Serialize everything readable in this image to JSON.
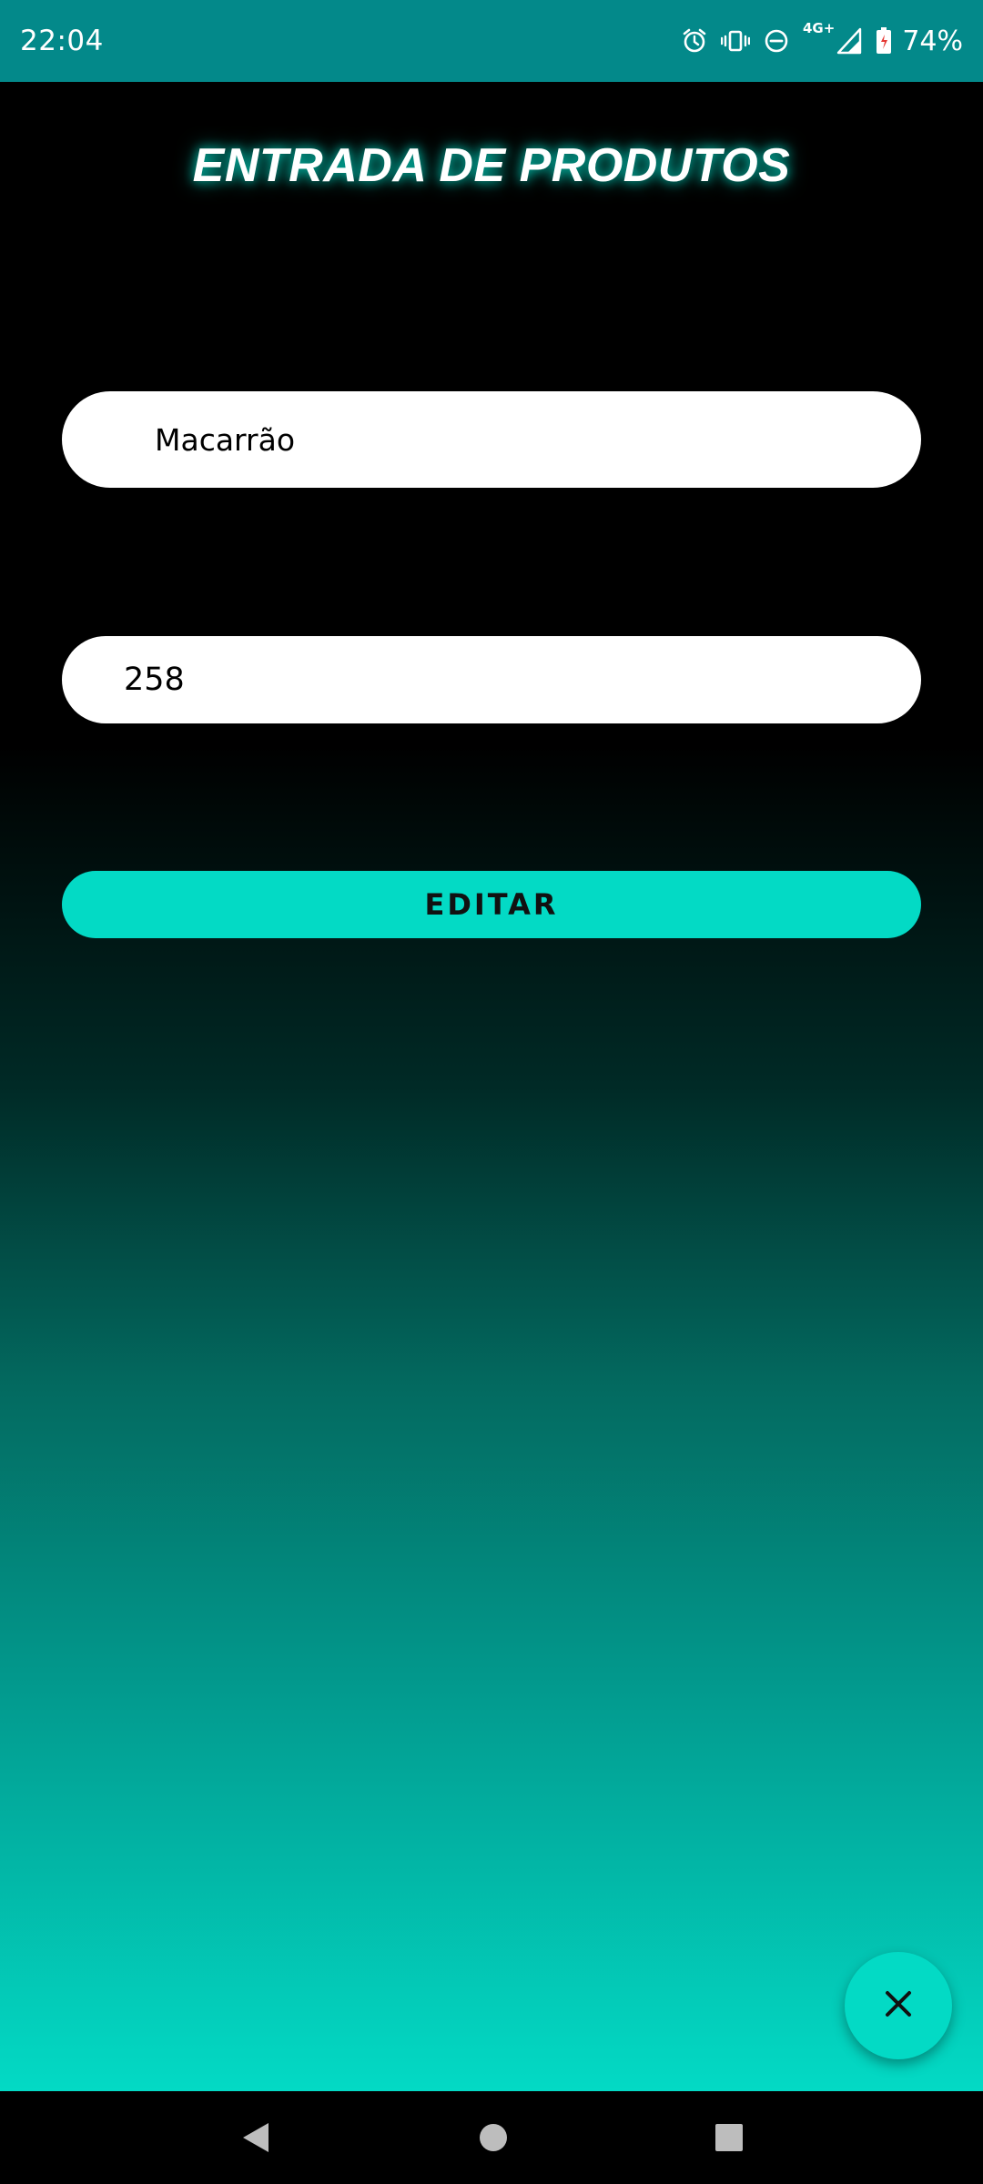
{
  "status_bar": {
    "time": "22:04",
    "network": "4G+",
    "battery": "74%",
    "icons": [
      "alarm-icon",
      "vibrate-icon",
      "do-not-disturb-icon",
      "signal-icon",
      "signal-icon",
      "battery-icon"
    ]
  },
  "page": {
    "title": "ENTRADA DE PRODUTOS"
  },
  "form": {
    "product_name": "Macarrão",
    "quantity": "258",
    "edit_label": "EDITAR"
  },
  "fab": {
    "icon": "close-icon"
  },
  "nav": {
    "icons": [
      "back-icon",
      "home-icon",
      "recents-icon"
    ]
  },
  "colors": {
    "status_bar": "#03898a",
    "accent": "#03dac5",
    "background_top": "#000000"
  }
}
